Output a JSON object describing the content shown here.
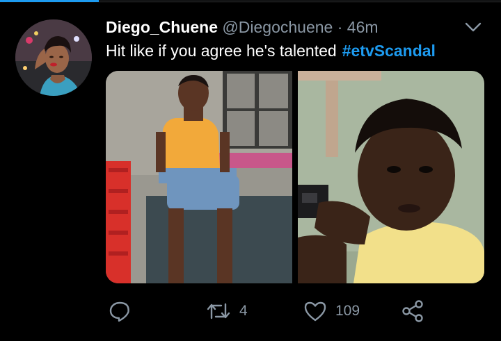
{
  "tweet": {
    "display_name": "Diego_Chuene",
    "handle": "@Diegochuene",
    "separator": "·",
    "time": "46m",
    "text": "Hit like if you agree he's talented",
    "hashtag": "#etvScandal"
  },
  "actions": {
    "retweet_count": "4",
    "like_count": "109"
  },
  "colors": {
    "accent": "#1d9bf0",
    "secondary_text": "#8b98a5",
    "background": "#000000"
  },
  "icons": [
    "reply-icon",
    "retweet-icon",
    "like-icon",
    "share-icon",
    "chevron-down-icon"
  ]
}
